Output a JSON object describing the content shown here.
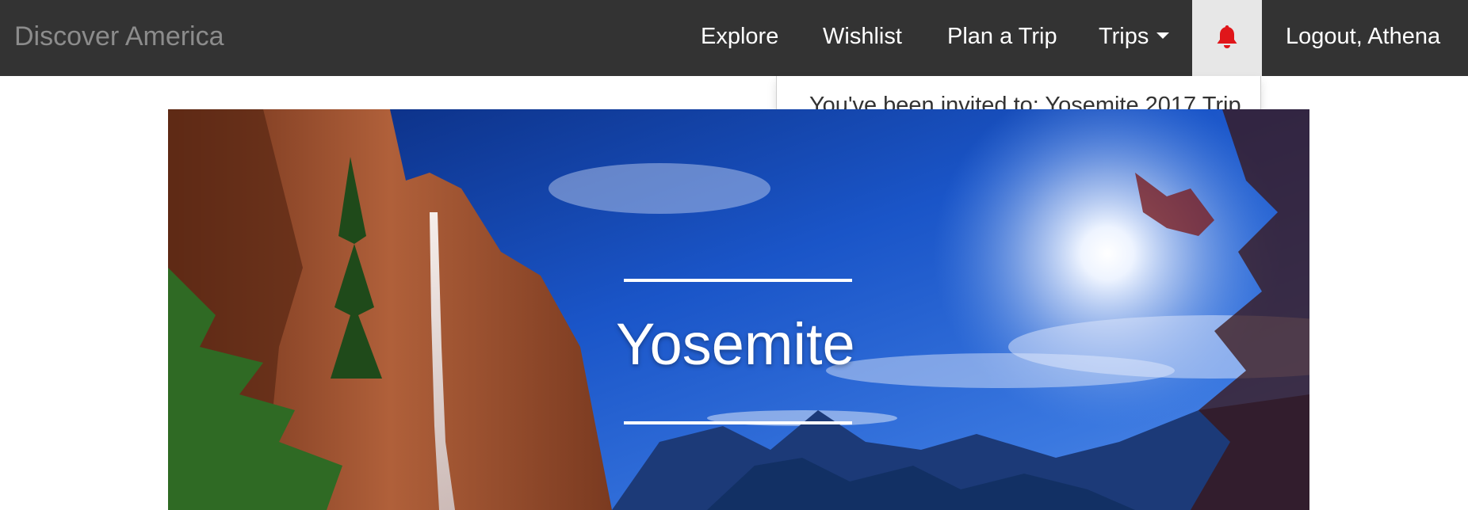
{
  "navbar": {
    "brand": "Discover America",
    "links": {
      "explore": "Explore",
      "wishlist": "Wishlist",
      "plan_trip": "Plan a Trip",
      "trips": "Trips",
      "logout": "Logout, Athena"
    },
    "notification_icon": "bell-icon",
    "notification_icon_color": "#e0161a"
  },
  "notifications": {
    "items": [
      {
        "text": "You've been invited to: Yosemite 2017 Trip"
      }
    ]
  },
  "hero": {
    "title": "Yosemite"
  },
  "colors": {
    "navbar_bg": "#333333",
    "brand_text": "#8c8c8c",
    "active_item_bg": "#e7e7e7"
  }
}
